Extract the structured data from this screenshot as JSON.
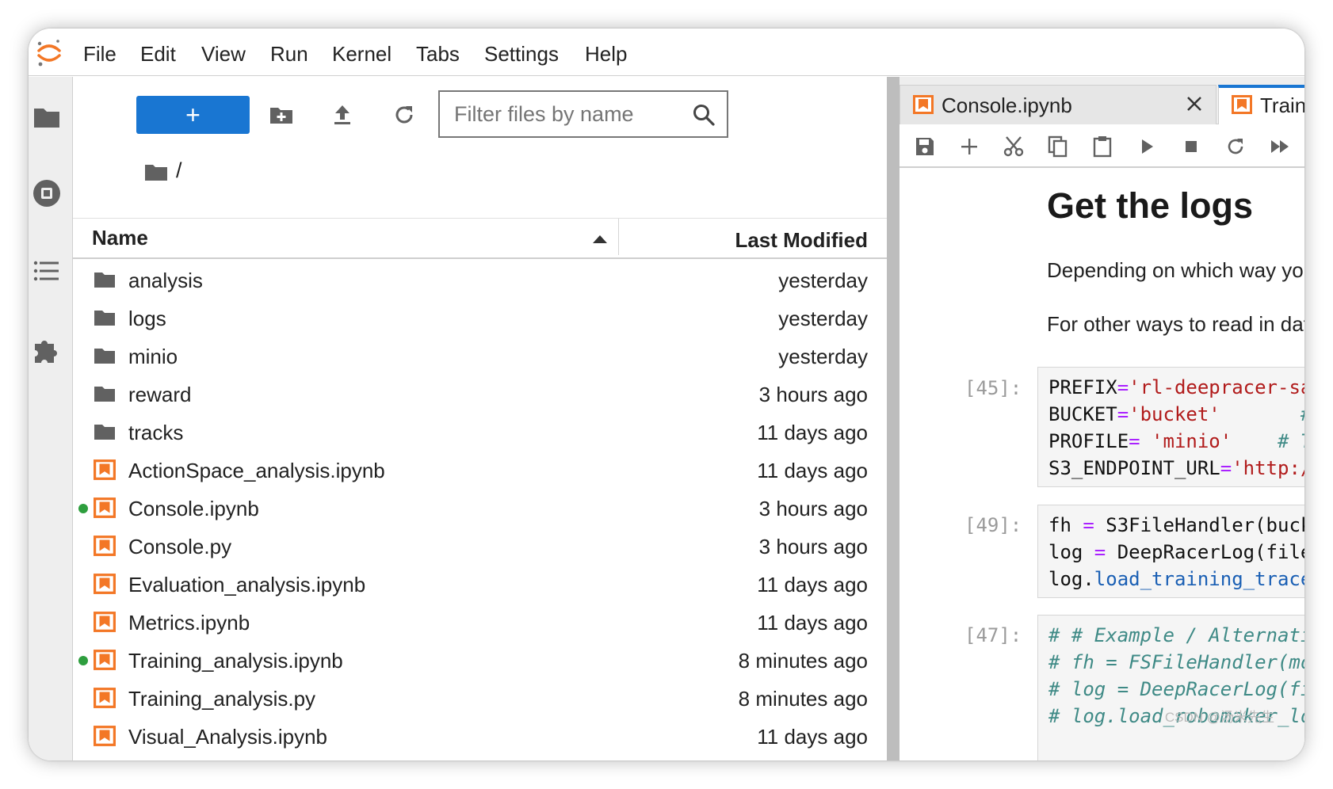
{
  "menubar": {
    "items": [
      "File",
      "Edit",
      "View",
      "Run",
      "Kernel",
      "Tabs",
      "Settings",
      "Help"
    ]
  },
  "activitybar": {
    "icons": [
      "folder-icon",
      "running-sessions-icon",
      "table-of-contents-icon",
      "extension-puzzle-icon"
    ]
  },
  "filebrowser": {
    "new_label": "+",
    "filter_placeholder": "Filter files by name",
    "breadcrumb": "/",
    "columns": {
      "name": "Name",
      "modified": "Last Modified"
    },
    "files": [
      {
        "name": "analysis",
        "modified": "yesterday",
        "type": "folder",
        "running": false
      },
      {
        "name": "logs",
        "modified": "yesterday",
        "type": "folder",
        "running": false
      },
      {
        "name": "minio",
        "modified": "yesterday",
        "type": "folder",
        "running": false
      },
      {
        "name": "reward",
        "modified": "3 hours ago",
        "type": "folder",
        "running": false
      },
      {
        "name": "tracks",
        "modified": "11 days ago",
        "type": "folder",
        "running": false
      },
      {
        "name": "ActionSpace_analysis.ipynb",
        "modified": "11 days ago",
        "type": "notebook",
        "running": false
      },
      {
        "name": "Console.ipynb",
        "modified": "3 hours ago",
        "type": "notebook",
        "running": true
      },
      {
        "name": "Console.py",
        "modified": "3 hours ago",
        "type": "notebook",
        "running": false
      },
      {
        "name": "Evaluation_analysis.ipynb",
        "modified": "11 days ago",
        "type": "notebook",
        "running": false
      },
      {
        "name": "Metrics.ipynb",
        "modified": "11 days ago",
        "type": "notebook",
        "running": false
      },
      {
        "name": "Training_analysis.ipynb",
        "modified": "8 minutes ago",
        "type": "notebook",
        "running": true
      },
      {
        "name": "Training_analysis.py",
        "modified": "8 minutes ago",
        "type": "notebook",
        "running": false
      },
      {
        "name": "Visual_Analysis.ipynb",
        "modified": "11 days ago",
        "type": "notebook",
        "running": false
      }
    ]
  },
  "notebook": {
    "tabs": [
      {
        "label": "Console.ipynb",
        "active": false
      },
      {
        "label": "Traini",
        "active": true
      }
    ],
    "heading": "Get the logs",
    "paragraphs": [
      "Depending on which way yo",
      "For other ways to read in dat"
    ],
    "cells": [
      {
        "prompt": "[45]:",
        "lines": [
          [
            {
              "t": "PREFIX",
              "c": ""
            },
            {
              "t": "=",
              "c": "op"
            },
            {
              "t": "'rl-deepracer-sa",
              "c": "str"
            }
          ],
          [
            {
              "t": "BUCKET",
              "c": ""
            },
            {
              "t": "=",
              "c": "op"
            },
            {
              "t": "'bucket'",
              "c": "str"
            },
            {
              "t": "       #",
              "c": "cm"
            }
          ],
          [
            {
              "t": "PROFILE",
              "c": ""
            },
            {
              "t": "=",
              "c": "op"
            },
            {
              "t": " 'minio'",
              "c": "str"
            },
            {
              "t": "    # T",
              "c": "cm"
            }
          ],
          [
            {
              "t": "S3_ENDPOINT_URL",
              "c": ""
            },
            {
              "t": "=",
              "c": "op"
            },
            {
              "t": "'http:/",
              "c": "str"
            }
          ]
        ]
      },
      {
        "prompt": "[49]:",
        "lines": [
          [
            {
              "t": "fh ",
              "c": ""
            },
            {
              "t": "=",
              "c": "op"
            },
            {
              "t": " S3FileHandler(buck",
              "c": ""
            }
          ],
          [
            {
              "t": "log ",
              "c": ""
            },
            {
              "t": "=",
              "c": "op"
            },
            {
              "t": " DeepRacerLog(file",
              "c": ""
            }
          ],
          [
            {
              "t": "log.",
              "c": ""
            },
            {
              "t": "load_training_trace",
              "c": "fn"
            }
          ]
        ]
      },
      {
        "prompt": "[47]:",
        "lines": [
          [
            {
              "t": "# # Example / Alternati",
              "c": "cm"
            }
          ],
          [
            {
              "t": "# fh = FSFileHandler(mo",
              "c": "cm"
            }
          ],
          [
            {
              "t": "# log = DeepRacerLog(fi",
              "c": "cm"
            }
          ],
          [
            {
              "t": "# log.load_robomaker_lo",
              "c": "cm"
            }
          ]
        ]
      }
    ]
  },
  "watermark": "CSDN @汤米先生",
  "colors": {
    "accent": "#1976d2",
    "notebook_icon": "#f37726",
    "running_dot": "#2e9e3e",
    "code_string": "#b11b1b",
    "code_operator": "#aa22ff",
    "code_comment": "#3f8a86",
    "code_function": "#1a5fb4"
  }
}
